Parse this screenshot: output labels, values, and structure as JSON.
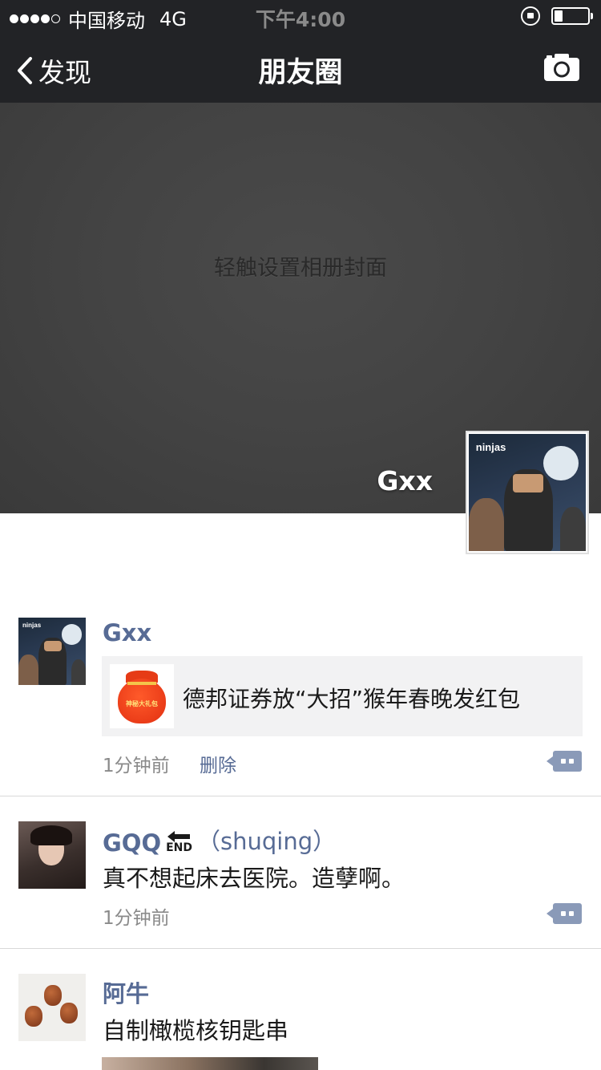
{
  "status_bar": {
    "carrier": "中国移动",
    "network": "4G",
    "time": "下午4:00",
    "battery_level": 0.25
  },
  "nav": {
    "back_label": "发现",
    "title": "朋友圈"
  },
  "cover": {
    "hint": "轻触设置相册封面",
    "profile_name": "Gxx",
    "avatar_logo": "ninjas"
  },
  "posts": [
    {
      "username": "Gxx",
      "link": {
        "title": "德邦证券放“大招”猴年春晚发红包",
        "thumb_label": "神秘大礼包"
      },
      "time": "1分钟前",
      "delete_label": "删除"
    },
    {
      "username": "GQQ",
      "username_badge": "END",
      "username_suffix": "（shuqing）",
      "text": "真不想起床去医院。造孽啊。",
      "time": "1分钟前"
    },
    {
      "username": "阿牛",
      "text": "自制橄榄核钥匙串"
    }
  ],
  "colors": {
    "bar_bg": "#222326",
    "link_blue": "#576b95",
    "meta_gray": "#8a8a8a"
  }
}
